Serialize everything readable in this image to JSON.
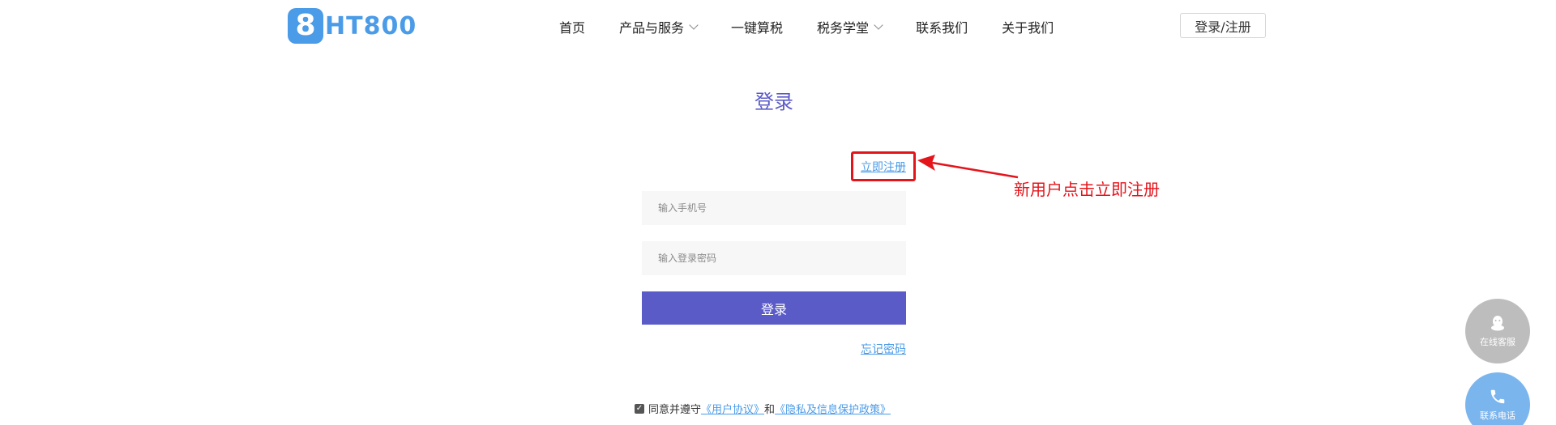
{
  "logo": {
    "badge": "8",
    "text": "HT800"
  },
  "nav": {
    "items": [
      {
        "label": "首页"
      },
      {
        "label": "产品与服务"
      },
      {
        "label": "一键算税"
      },
      {
        "label": "税务学堂"
      },
      {
        "label": "联系我们"
      },
      {
        "label": "关于我们"
      }
    ],
    "login_register": "登录/注册"
  },
  "page_title": "登录",
  "register_link": "立即注册",
  "annotation": {
    "text": "新用户点击立即注册",
    "color": "#e4141b"
  },
  "form": {
    "phone_placeholder": "输入手机号",
    "password_placeholder": "输入登录密码",
    "login_button": "登录",
    "forgot_password": "忘记密码"
  },
  "agreement": {
    "checked": true,
    "prefix": "同意并遵守",
    "user_agreement": "《用户协议》",
    "and": "和",
    "privacy_policy": "《隐私及信息保护政策》"
  },
  "float": {
    "service_label": "在线客服",
    "phone_label": "联系电话"
  },
  "colors": {
    "primary": "#5b5bc8",
    "link": "#4a9be8",
    "brand": "#4a9be8"
  }
}
